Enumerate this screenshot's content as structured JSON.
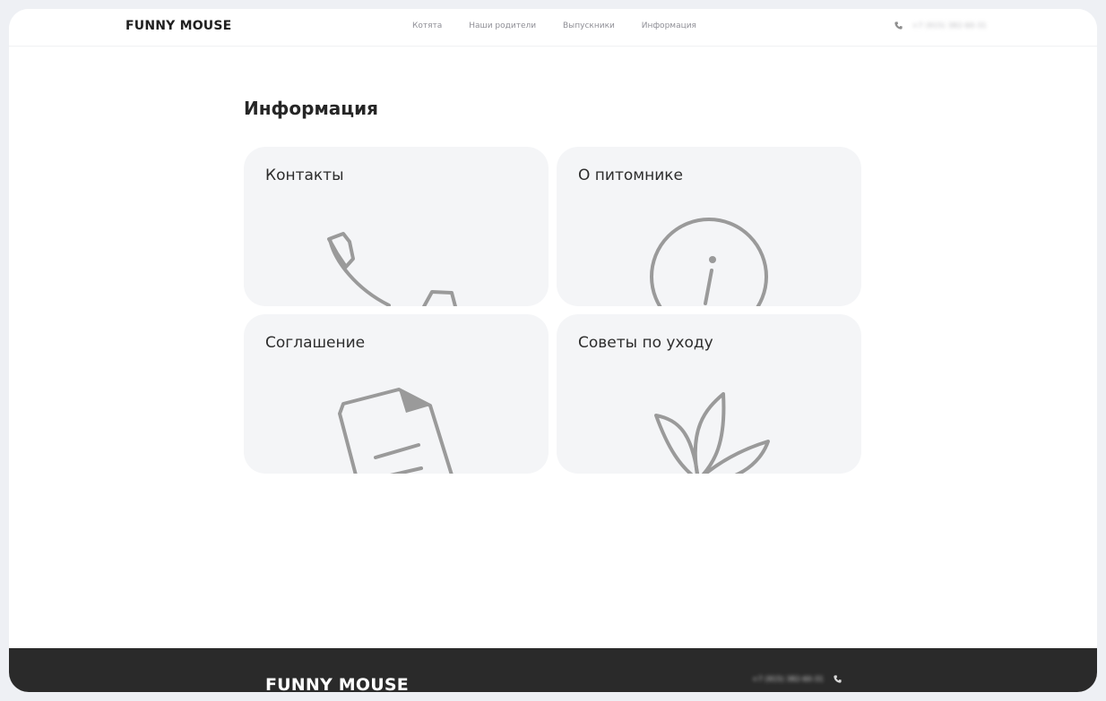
{
  "header": {
    "brand": "FUNNY MOUSE",
    "nav": [
      "Котята",
      "Наши родители",
      "Выпускники",
      "Информация"
    ],
    "phone": "+7 (915) 382-60-31"
  },
  "main": {
    "title": "Информация",
    "cards": [
      {
        "title": "Контакты",
        "icon": "phone-icon"
      },
      {
        "title": "О питомнике",
        "icon": "info-icon"
      },
      {
        "title": "Соглашение",
        "icon": "document-icon"
      },
      {
        "title": "Советы по уходу",
        "icon": "leaf-icon"
      }
    ]
  },
  "footer": {
    "brand": "FUNNY MOUSE",
    "phone": "+7 (915) 382-60-31"
  },
  "colors": {
    "accent": "#9a9a9a",
    "card_bg": "#f4f5f7",
    "footer_bg": "#2a2a2a",
    "text": "#262626"
  }
}
